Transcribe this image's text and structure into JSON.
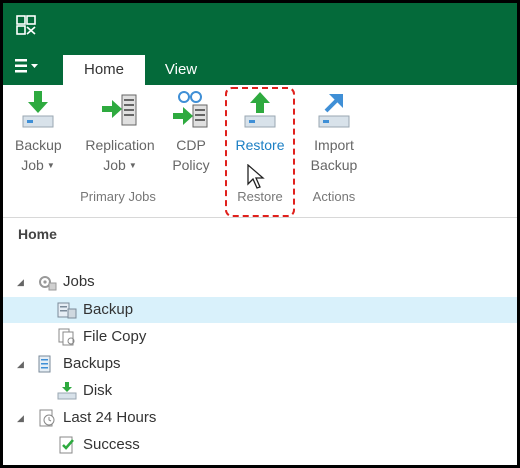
{
  "app": {
    "logo_icon": "veeam-logo-icon"
  },
  "colors": {
    "title_bar": "#046a3a",
    "selection": "#d9f1fb",
    "highlight": "#e0201c",
    "accent_blue": "#1b7fc4",
    "accent_green": "#2eaa3f"
  },
  "menu": {
    "icon": "hamburger-menu-icon"
  },
  "tabs": [
    {
      "label": "Home",
      "active": true
    },
    {
      "label": "View",
      "active": false
    }
  ],
  "ribbon": {
    "groups": [
      {
        "label": "Primary Jobs"
      },
      {
        "label": "Restore"
      },
      {
        "label": "Actions"
      }
    ],
    "buttons": {
      "backup_job": {
        "line1": "Backup",
        "line2": "Job",
        "icon": "backup-job-icon"
      },
      "replication_job": {
        "line1": "Replication",
        "line2": "Job",
        "icon": "replication-job-icon"
      },
      "cdp_policy": {
        "line1": "CDP",
        "line2": "Policy",
        "icon": "cdp-policy-icon"
      },
      "restore": {
        "line1": "Restore",
        "icon": "restore-icon"
      },
      "import_backup": {
        "line1": "Import",
        "line2": "Backup",
        "icon": "import-backup-icon"
      }
    }
  },
  "navigation": {
    "title": "Home",
    "tree": [
      {
        "label": "Jobs",
        "expanded": true,
        "icon": "jobs-icon"
      },
      {
        "label": "Backup",
        "selected": true,
        "icon": "backup-job-node-icon"
      },
      {
        "label": "File Copy",
        "icon": "file-copy-icon"
      },
      {
        "label": "Backups",
        "expanded": true,
        "icon": "backups-icon"
      },
      {
        "label": "Disk",
        "icon": "disk-icon"
      },
      {
        "label": "Last 24 Hours",
        "expanded": true,
        "icon": "last-24-hours-icon"
      },
      {
        "label": "Success",
        "icon": "success-icon"
      }
    ]
  }
}
